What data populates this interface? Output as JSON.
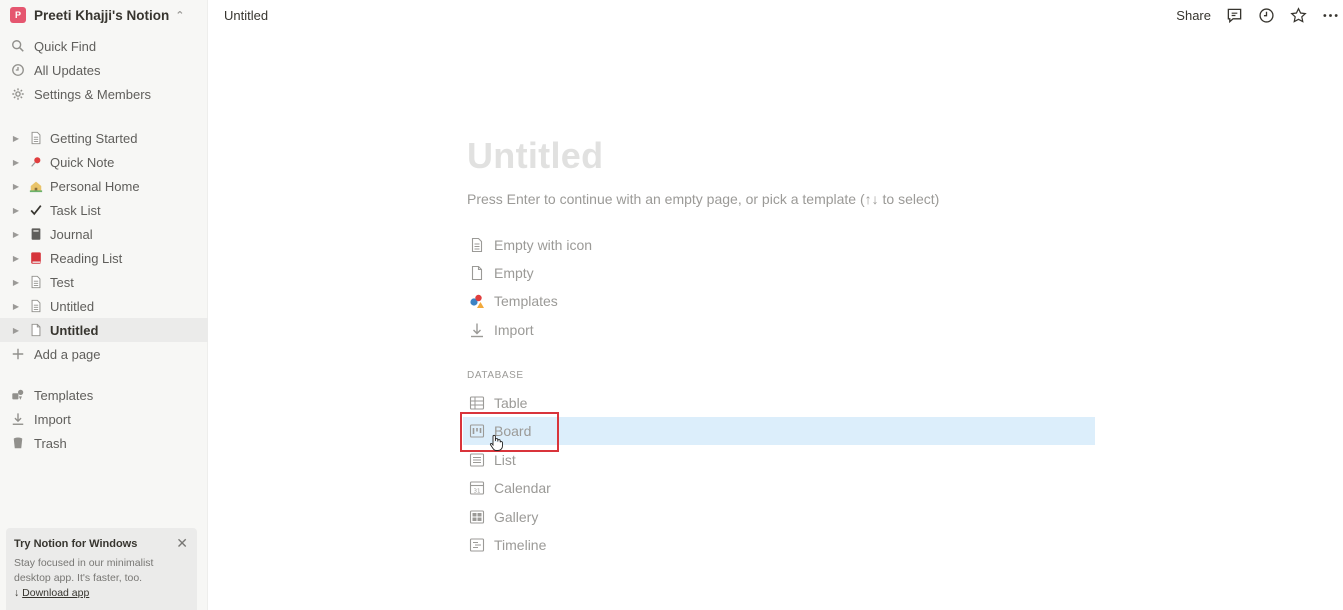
{
  "workspace": {
    "initial": "P",
    "name": "Preeti Khajji's Notion",
    "avatar_color": "#e5566f"
  },
  "sidebar": {
    "nav": [
      {
        "label": "Quick Find",
        "icon": "search-icon"
      },
      {
        "label": "All Updates",
        "icon": "clock-icon"
      },
      {
        "label": "Settings & Members",
        "icon": "gear-icon"
      }
    ],
    "pages": [
      {
        "label": "Getting Started",
        "icon": "page-icon"
      },
      {
        "label": "Quick Note",
        "icon": "pushpin-icon"
      },
      {
        "label": "Personal Home",
        "icon": "house-icon"
      },
      {
        "label": "Task List",
        "icon": "checkmark-icon"
      },
      {
        "label": "Journal",
        "icon": "notebook-icon"
      },
      {
        "label": "Reading List",
        "icon": "book-icon"
      },
      {
        "label": "Test",
        "icon": "page-icon"
      },
      {
        "label": "Untitled",
        "icon": "page-icon"
      },
      {
        "label": "Untitled",
        "icon": "page-blank-icon",
        "active": true
      }
    ],
    "add_page": "Add a page",
    "bottom": [
      {
        "label": "Templates",
        "icon": "templates-icon"
      },
      {
        "label": "Import",
        "icon": "import-icon"
      },
      {
        "label": "Trash",
        "icon": "trash-icon"
      }
    ],
    "promo": {
      "title": "Try Notion for Windows",
      "body": "Stay focused in our minimalist desktop app. It's faster, too.",
      "link_prefix": "↓",
      "link": "Download app"
    }
  },
  "topbar": {
    "breadcrumb": "Untitled",
    "share": "Share"
  },
  "main": {
    "title": "Untitled",
    "hint": "Press Enter to continue with an empty page, or pick a template (↑↓ to select)",
    "options": [
      "Empty with icon",
      "Empty",
      "Templates",
      "Import"
    ],
    "database_header": "DATABASE",
    "database_options": [
      "Table",
      "Board",
      "List",
      "Calendar",
      "Gallery",
      "Timeline"
    ],
    "hovered_option": "Board",
    "hover_color": "#dceefb",
    "highlight_color": "#d9343b"
  }
}
